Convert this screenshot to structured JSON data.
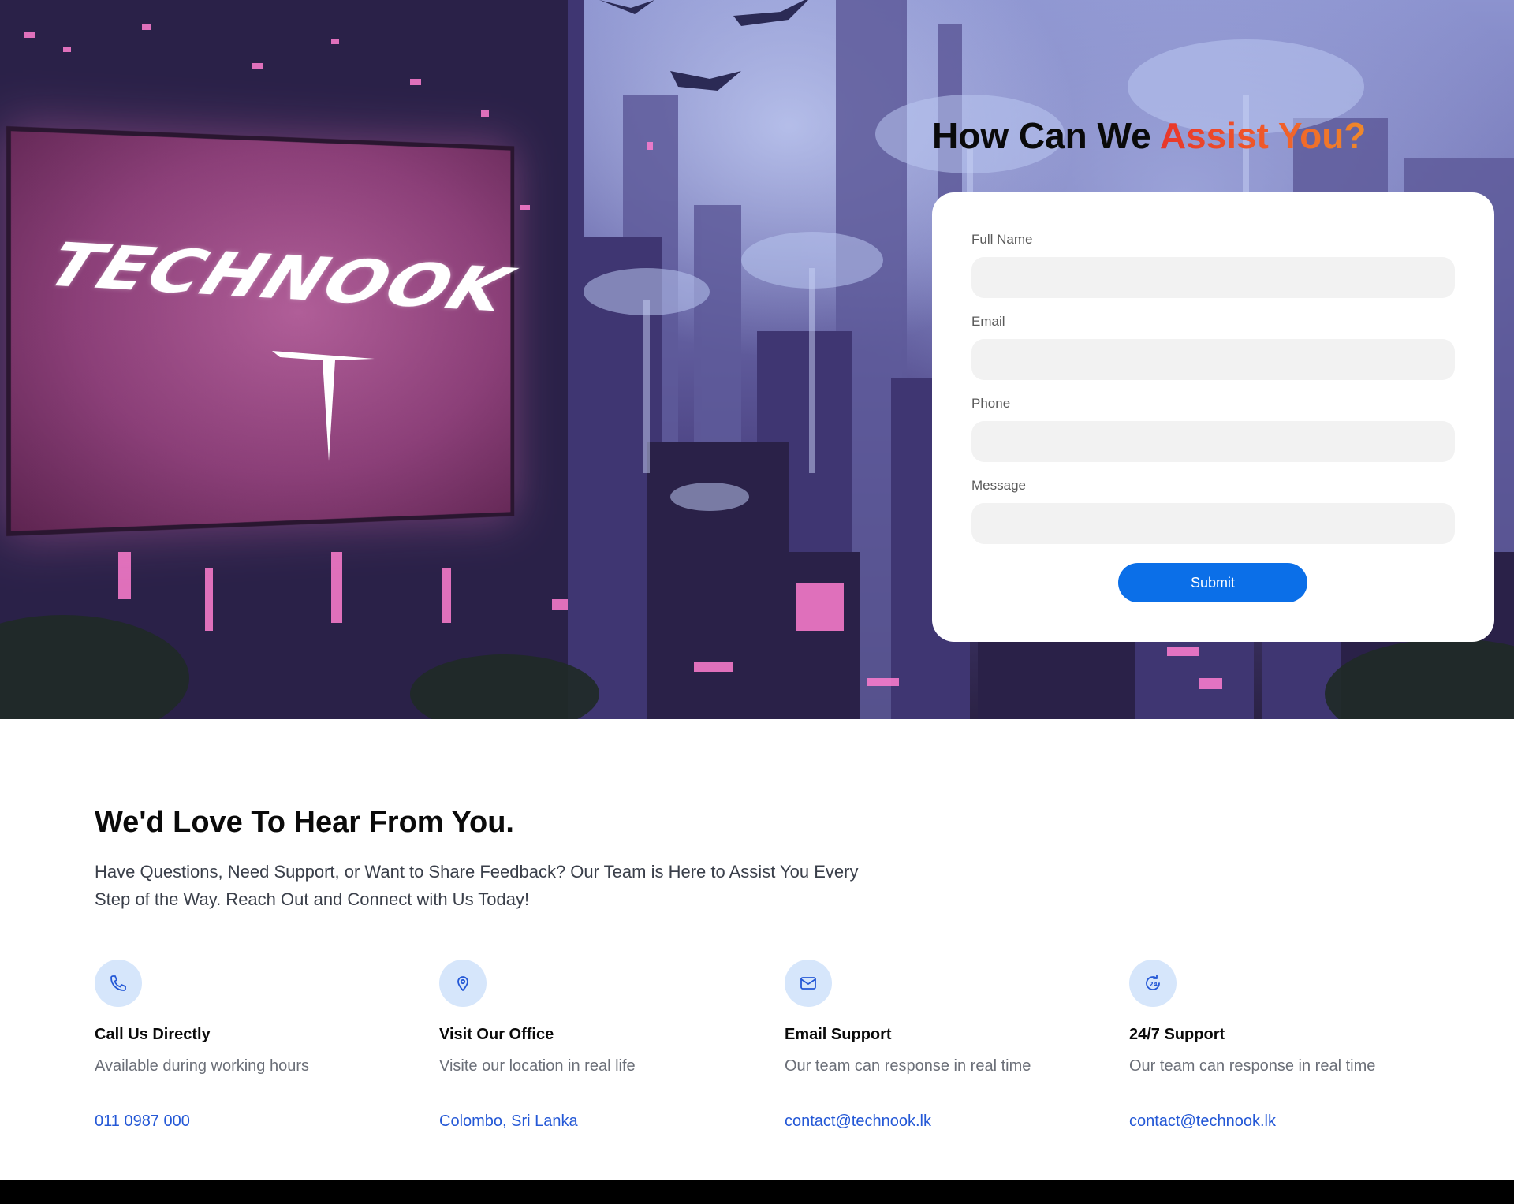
{
  "hero": {
    "logo_text": "TECHNOOK",
    "title_main": "How Can We ",
    "title_accent": "Assist You?"
  },
  "form": {
    "fields": [
      {
        "label": "Full Name",
        "value": "",
        "placeholder": ""
      },
      {
        "label": "Email",
        "value": "",
        "placeholder": ""
      },
      {
        "label": "Phone",
        "value": "",
        "placeholder": ""
      },
      {
        "label": "Message",
        "value": "",
        "placeholder": ""
      }
    ],
    "submit_label": "Submit"
  },
  "contact": {
    "title": "We'd Love To Hear From You.",
    "description": "Have Questions, Need Support, or Want to Share Feedback? Our Team is Here to Assist You Every Step of the Way. Reach Out and Connect with Us Today!",
    "items": [
      {
        "icon": "phone-icon",
        "title": "Call Us Directly",
        "subtitle": "Available during working hours",
        "link": "011 0987 000"
      },
      {
        "icon": "location-pin-icon",
        "title": "Visit Our Office",
        "subtitle": "Visite our location in real life",
        "link": "Colombo, Sri Lanka"
      },
      {
        "icon": "mail-icon",
        "title": "Email Support",
        "subtitle": "Our team can response in real time",
        "link": "contact@technook.lk"
      },
      {
        "icon": "support-24-icon",
        "title": "24/7 Support",
        "subtitle": "Our team can response in real time",
        "link": "contact@technook.lk"
      }
    ]
  },
  "colors": {
    "accent_blue": "#0b6fe8",
    "link_blue": "#2458d6",
    "title_accent": "#e8362a",
    "icon_bg": "#d6e6fb"
  }
}
